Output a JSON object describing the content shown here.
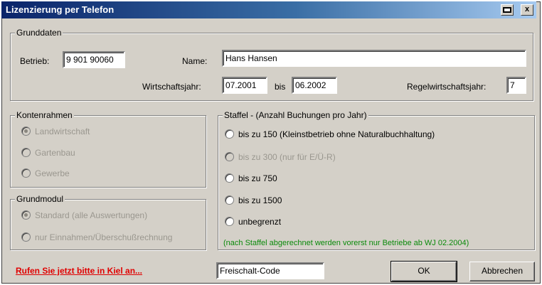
{
  "window": {
    "title": "Lizenzierung per Telefon",
    "controls": {
      "help_icon": "help-icon",
      "close_label": "x"
    }
  },
  "grunddaten": {
    "legend": "Grunddaten",
    "betrieb_label": "Betrieb:",
    "betrieb_value": "9 901 90060",
    "name_label": "Name:",
    "name_value": "Hans Hansen",
    "wj_label": "Wirtschaftsjahr:",
    "wj_from": "07.2001",
    "bis_label": "bis",
    "wj_to": "06.2002",
    "regel_label": "Regelwirtschaftsjahr:",
    "regel_value": "7"
  },
  "kontenrahmen": {
    "legend": "Kontenrahmen",
    "options": [
      {
        "label": "Landwirtschaft",
        "selected": true
      },
      {
        "label": "Gartenbau",
        "selected": false
      },
      {
        "label": "Gewerbe",
        "selected": false
      }
    ]
  },
  "grundmodul": {
    "legend": "Grundmodul",
    "options": [
      {
        "label": "Standard (alle Auswertungen)",
        "selected": true
      },
      {
        "label": "nur Einnahmen/Überschußrechnung",
        "selected": false
      }
    ]
  },
  "staffel": {
    "legend": "Staffel - (Anzahl Buchungen pro Jahr)",
    "options": [
      {
        "label": "bis zu 150 (Kleinstbetrieb ohne Naturalbuchhaltung)",
        "selected": false,
        "disabled": false
      },
      {
        "label": "bis zu 300 (nur für E/Ü-R)",
        "selected": false,
        "disabled": true
      },
      {
        "label": "bis zu 750",
        "selected": false,
        "disabled": false
      },
      {
        "label": "bis zu 1500",
        "selected": false,
        "disabled": false
      },
      {
        "label": "unbegrenzt",
        "selected": false,
        "disabled": false
      }
    ],
    "note": "(nach Staffel abgerechnet werden vorerst nur Betriebe ab WJ 02.2004)"
  },
  "footer": {
    "call_link": "Rufen Sie jetzt bitte in Kiel an...",
    "code_value": "Freischalt-Code",
    "ok_label": "OK",
    "cancel_label": "Abbrechen"
  },
  "colors": {
    "title_start": "#0a246a",
    "note_green": "#0a8a0a",
    "link_red": "#e00000",
    "face": "#d4d0c8"
  }
}
